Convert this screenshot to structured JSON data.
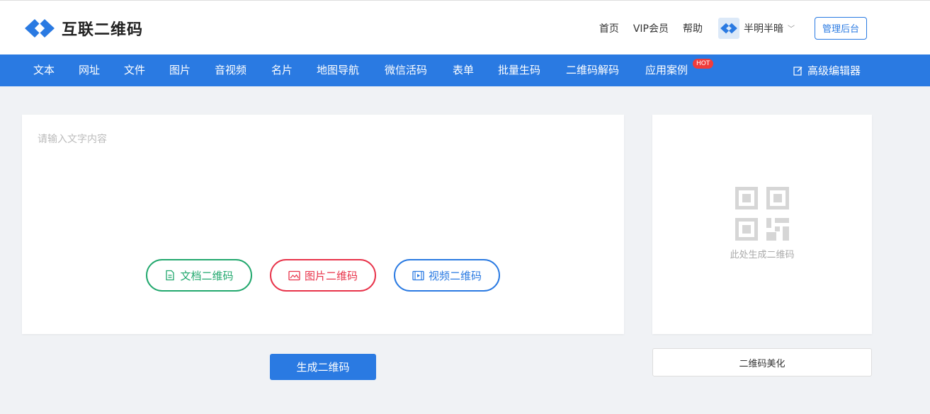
{
  "brand": {
    "name": "互联二维码",
    "accent": "#2a7ae2"
  },
  "topnav": {
    "links": [
      "首页",
      "VIP会员",
      "帮助"
    ],
    "user_name": "半明半暗",
    "admin_label": "管理后台"
  },
  "tabs": [
    {
      "label": "文本",
      "active": true
    },
    {
      "label": "网址"
    },
    {
      "label": "文件"
    },
    {
      "label": "图片"
    },
    {
      "label": "音视频"
    },
    {
      "label": "名片"
    },
    {
      "label": "地图导航"
    },
    {
      "label": "微信活码"
    },
    {
      "label": "表单"
    },
    {
      "label": "批量生码"
    },
    {
      "label": "二维码解码"
    },
    {
      "label": "应用案例",
      "badge": "HOT"
    }
  ],
  "advanced_editor_label": "高级编辑器",
  "editor": {
    "placeholder": "请输入文字内容",
    "value": "",
    "doc_button": "文档二维码",
    "image_button": "图片二维码",
    "video_button": "视频二维码"
  },
  "generate_label": "生成二维码",
  "preview": {
    "hint": "此处生成二维码"
  },
  "beautify_label": "二维码美化",
  "colors": {
    "doc": "#22a86e",
    "image": "#e8334a",
    "video": "#2a7ae2",
    "hot": "#f03c3c"
  }
}
